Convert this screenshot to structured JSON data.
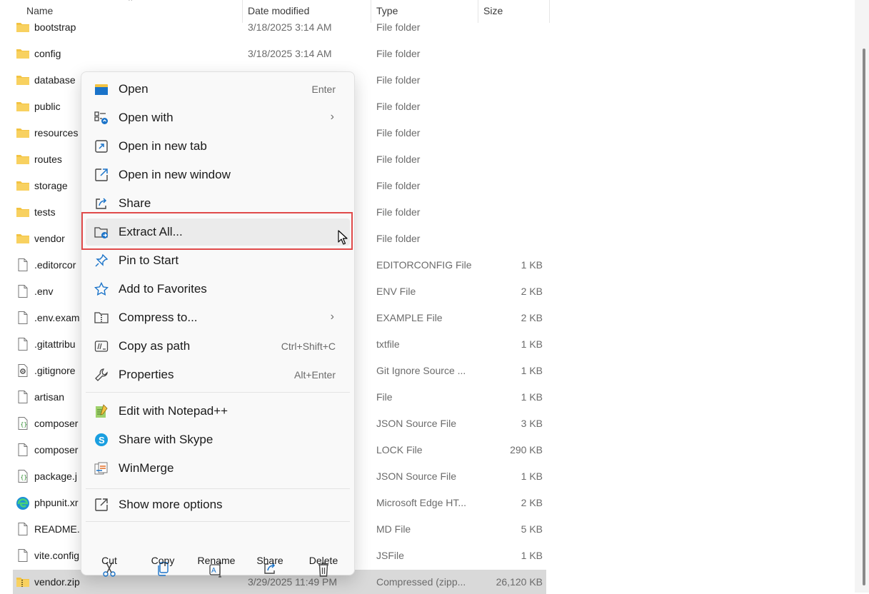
{
  "columns": {
    "name": "Name",
    "date_modified": "Date modified",
    "type": "Type",
    "size": "Size"
  },
  "files": [
    {
      "name": "bootstrap",
      "date": "3/18/2025 3:14 AM",
      "type": "File folder",
      "size": "",
      "icon": "folder-icon"
    },
    {
      "name": "config",
      "date": "3/18/2025 3:14 AM",
      "type": "File folder",
      "size": "",
      "icon": "folder-icon"
    },
    {
      "name": "database",
      "date": "",
      "type": "File folder",
      "size": "",
      "icon": "folder-icon"
    },
    {
      "name": "public",
      "date": "",
      "type": "File folder",
      "size": "",
      "icon": "folder-icon"
    },
    {
      "name": "resources",
      "date": "",
      "type": "File folder",
      "size": "",
      "icon": "folder-icon"
    },
    {
      "name": "routes",
      "date": "",
      "type": "File folder",
      "size": "",
      "icon": "folder-icon"
    },
    {
      "name": "storage",
      "date": "",
      "type": "File folder",
      "size": "",
      "icon": "folder-icon"
    },
    {
      "name": "tests",
      "date": "",
      "type": "File folder",
      "size": "",
      "icon": "folder-icon"
    },
    {
      "name": "vendor",
      "date": "",
      "type": "File folder",
      "size": "",
      "icon": "folder-icon"
    },
    {
      "name": ".editorcor",
      "date": "",
      "type": "EDITORCONFIG File",
      "size": "1 KB",
      "icon": "file-icon"
    },
    {
      "name": ".env",
      "date": "",
      "type": "ENV File",
      "size": "2 KB",
      "icon": "file-icon"
    },
    {
      "name": ".env.exam",
      "date": "",
      "type": "EXAMPLE File",
      "size": "2 KB",
      "icon": "file-icon"
    },
    {
      "name": ".gitattribu",
      "date": "",
      "type": "txtfile",
      "size": "1 KB",
      "icon": "file-icon"
    },
    {
      "name": ".gitignore",
      "date": "",
      "type": "Git Ignore Source ...",
      "size": "1 KB",
      "icon": "gear-file-icon"
    },
    {
      "name": "artisan",
      "date": "",
      "type": "File",
      "size": "1 KB",
      "icon": "file-icon"
    },
    {
      "name": "composer",
      "date": "",
      "type": "JSON Source File",
      "size": "3 KB",
      "icon": "json-file-icon"
    },
    {
      "name": "composer",
      "date": "",
      "type": "LOCK File",
      "size": "290 KB",
      "icon": "file-icon"
    },
    {
      "name": "package.j",
      "date": "",
      "type": "JSON Source File",
      "size": "1 KB",
      "icon": "json-file-icon"
    },
    {
      "name": "phpunit.xr",
      "date": "",
      "type": "Microsoft Edge HT...",
      "size": "2 KB",
      "icon": "edge-icon"
    },
    {
      "name": "README.",
      "date": "",
      "type": "MD File",
      "size": "5 KB",
      "icon": "file-icon"
    },
    {
      "name": "vite.config",
      "date": "",
      "type": "JSFile",
      "size": "1 KB",
      "icon": "file-icon"
    },
    {
      "name": "vendor.zip",
      "date": "3/29/2025 11:49 PM",
      "type": "Compressed (zipp...",
      "size": "26,120 KB",
      "icon": "zip-folder-icon",
      "selected": true
    }
  ],
  "context_menu": {
    "items": [
      {
        "id": "open",
        "label": "Open",
        "shortcut": "Enter",
        "icon": "open-icon"
      },
      {
        "id": "open-with",
        "label": "Open with",
        "submenu": true,
        "icon": "open-with-icon"
      },
      {
        "id": "open-new-tab",
        "label": "Open in new tab",
        "icon": "new-tab-icon"
      },
      {
        "id": "open-new-window",
        "label": "Open in new window",
        "icon": "new-window-icon"
      },
      {
        "id": "share",
        "label": "Share",
        "icon": "share-icon"
      },
      {
        "id": "extract-all",
        "label": "Extract All...",
        "icon": "extract-icon",
        "hovered": true
      },
      {
        "id": "pin-to-start",
        "label": "Pin to Start",
        "icon": "pin-icon"
      },
      {
        "id": "add-to-favorites",
        "label": "Add to Favorites",
        "icon": "star-icon"
      },
      {
        "id": "compress-to",
        "label": "Compress to...",
        "submenu": true,
        "icon": "compress-icon"
      },
      {
        "id": "copy-as-path",
        "label": "Copy as path",
        "shortcut": "Ctrl+Shift+C",
        "icon": "copy-path-icon"
      },
      {
        "id": "properties",
        "label": "Properties",
        "shortcut": "Alt+Enter",
        "icon": "wrench-icon"
      },
      {
        "id": "edit-notepadpp",
        "label": "Edit with Notepad++",
        "icon": "notepadpp-icon"
      },
      {
        "id": "share-skype",
        "label": "Share with Skype",
        "icon": "skype-icon"
      },
      {
        "id": "winmerge",
        "label": "WinMerge",
        "icon": "winmerge-icon"
      },
      {
        "id": "show-more",
        "label": "Show more options",
        "icon": "show-more-icon"
      }
    ],
    "commands": [
      {
        "id": "cut",
        "label": "Cut",
        "icon": "scissors-icon"
      },
      {
        "id": "copy",
        "label": "Copy",
        "icon": "copy-icon"
      },
      {
        "id": "rename",
        "label": "Rename",
        "icon": "rename-icon"
      },
      {
        "id": "share",
        "label": "Share",
        "icon": "share-icon"
      },
      {
        "id": "delete",
        "label": "Delete",
        "icon": "trash-icon"
      }
    ]
  },
  "colors": {
    "folder": "#f3c342",
    "accent": "#1a73c9",
    "highlight_border": "#e04a4a",
    "selection": "#d9d9d9"
  }
}
